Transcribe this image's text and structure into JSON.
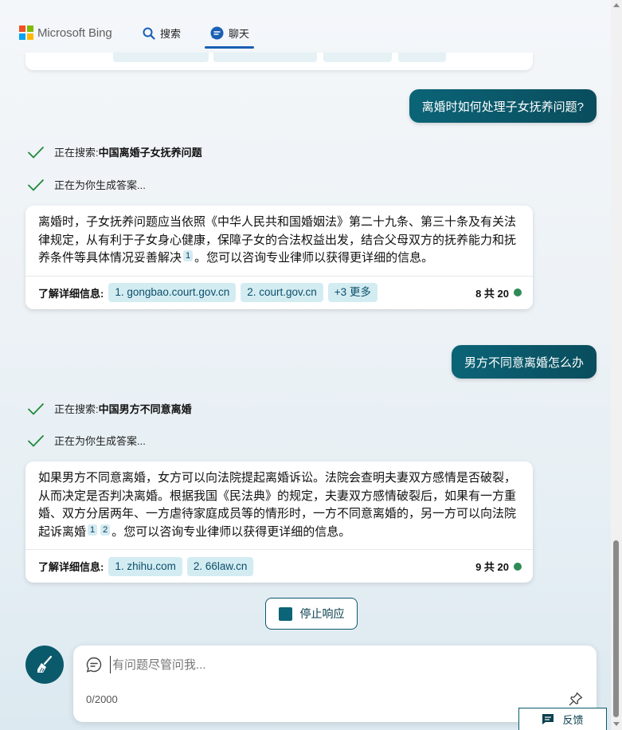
{
  "header": {
    "brand": "Microsoft Bing",
    "logo_colors": [
      "#f25022",
      "#7fba00",
      "#00a4ef",
      "#ffb900"
    ],
    "tabs": [
      {
        "label": "搜索",
        "icon": "search-icon"
      },
      {
        "label": "聊天",
        "icon": "chat-icon",
        "active": true
      }
    ]
  },
  "conversation": {
    "turns": [
      {
        "user_message": "离婚时如何处理子女抚养问题?",
        "status": [
          {
            "prefix": "正在搜索: ",
            "query": "中国离婚子女抚养问题"
          },
          {
            "prefix": "正在为你生成答案...",
            "query": ""
          }
        ],
        "answer_parts": [
          "离婚时，子女抚养问题应当依照《中华人民共和国婚姻法》第二十九条、第三十条及有关法律规定，从有利于子女身心健康，保障子女的合法权益出发，结合父母双方的抚养能力和抚养条件等具体情况妥善解决",
          "。您可以咨询专业律师以获得更详细的信息。"
        ],
        "citations": [
          "1"
        ],
        "learn_more_label": "了解详细信息:",
        "sources": [
          "1. gongbao.court.gov.cn",
          "2. court.gov.cn",
          "+3 更多"
        ],
        "count": "8 共 20"
      },
      {
        "user_message": "男方不同意离婚怎么办",
        "status": [
          {
            "prefix": "正在搜索: ",
            "query": "中国男方不同意离婚"
          },
          {
            "prefix": "正在为你生成答案...",
            "query": ""
          }
        ],
        "answer_parts": [
          "如果男方不同意离婚，女方可以向法院提起离婚诉讼。法院会查明夫妻双方感情是否破裂，从而决定是否判决离婚。根据我国《民法典》的规定，夫妻双方感情破裂后，如果有一方重婚、双方分居两年、一方虐待家庭成员等的情形时，一方不同意离婚的，另一方可以向法院起诉离婚",
          "。您可以咨询专业律师以获得更详细的信息。"
        ],
        "citations": [
          "1",
          "2"
        ],
        "learn_more_label": "了解详细信息:",
        "sources": [
          "1. zhihu.com",
          "2. 66law.cn"
        ],
        "count": "9 共 20"
      }
    ]
  },
  "stop_button": {
    "label": "停止响应"
  },
  "composer": {
    "placeholder": "有问题尽管问我...",
    "value": "",
    "char_count": "0/2000"
  },
  "feedback": {
    "label": "反馈"
  },
  "colors": {
    "accent": "#0a5a6c",
    "status_dot": "#2e8b57",
    "check": "#1e8a3c"
  }
}
